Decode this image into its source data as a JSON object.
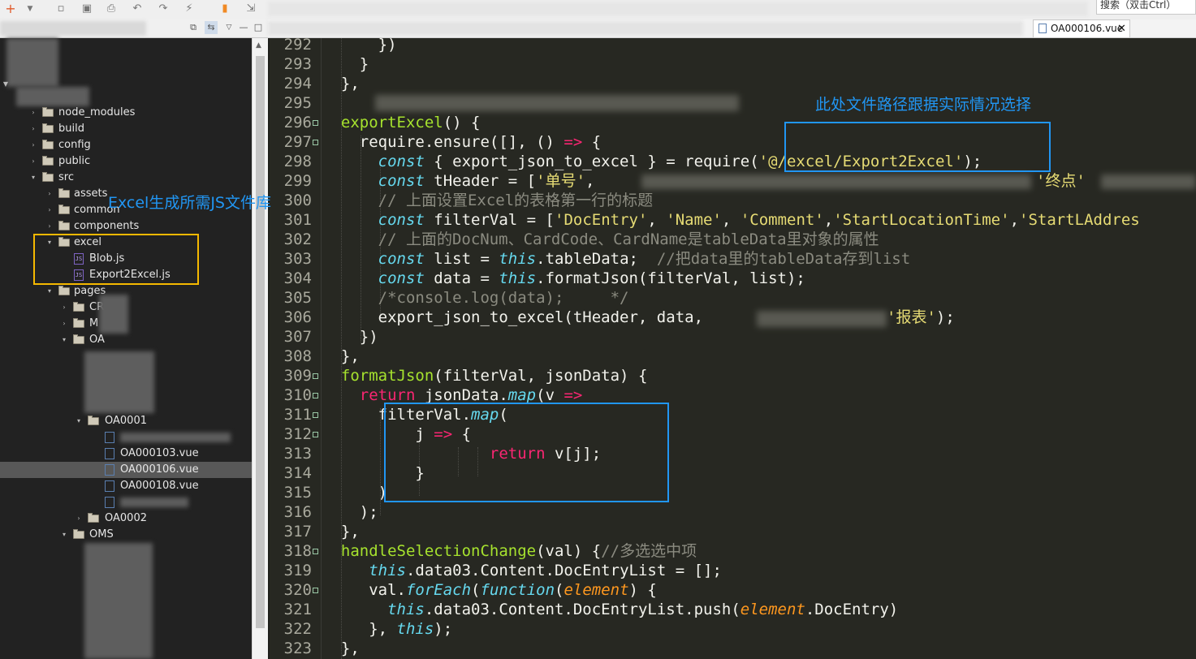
{
  "toolbar": {
    "search_placeholder": "搜索（双击Ctrl）"
  },
  "editor_tab": {
    "label": "OA000106.vue",
    "close": "✕"
  },
  "explorer": {
    "items": [
      {
        "label": "node_modules"
      },
      {
        "label": "build"
      },
      {
        "label": "config"
      },
      {
        "label": "public"
      },
      {
        "label": "src"
      },
      {
        "label": "assets"
      },
      {
        "label": "common"
      },
      {
        "label": "components"
      },
      {
        "label": "excel"
      },
      {
        "label": "Blob.js"
      },
      {
        "label": "Export2Excel.js"
      },
      {
        "label": "pages"
      },
      {
        "label": "CR"
      },
      {
        "label": "M"
      },
      {
        "label": "OA"
      },
      {
        "label": "OA0001"
      },
      {
        "label": "OA000103.vue"
      },
      {
        "label": "OA000106.vue"
      },
      {
        "label": "OA000108.vue"
      },
      {
        "label": "OA0002"
      },
      {
        "label": "OMS"
      }
    ]
  },
  "gutter": {
    "lines": [
      "292",
      "293",
      "294",
      "295",
      "296",
      "297",
      "298",
      "299",
      "300",
      "301",
      "302",
      "303",
      "304",
      "305",
      "306",
      "307",
      "308",
      "309",
      "310",
      "311",
      "312",
      "313",
      "314",
      "315",
      "316",
      "317",
      "318",
      "319",
      "320",
      "321",
      "322",
      "323"
    ]
  },
  "code": {
    "l292": "      })",
    "l293": "    }",
    "l294": "  },",
    "l296_name": "exportExcel",
    "l296_rest": "() {",
    "l297_a": "    require.ensure([], () ",
    "l297_op": "=>",
    "l297_b": " {",
    "l298_kw": "const",
    "l298_a": " { export_json_to_excel } = require(",
    "l298_str": "'@/excel/Export2Excel'",
    "l298_b": ");",
    "l299_kw": "const",
    "l299_a": " tHeader = [",
    "l299_s1": "'单号'",
    "l299_sep": ", ",
    "l299_s2": "'终点'",
    "l300": "// 上面设置Excel的表格第一行的标题",
    "l301_kw": "const",
    "l301_a": " filterVal = [",
    "l301_s1": "'DocEntry'",
    "l301_s2": "'Name'",
    "l301_s3": "'Comment'",
    "l301_s4": "'StartLocationTime'",
    "l301_s5": "'StartLAddres",
    "l302": "// 上面的DocNum、CardCode、CardName是tableData里对象的属性",
    "l303_kw": "const",
    "l303_a": " list = ",
    "l303_this": "this",
    "l303_b": ".tableData;  ",
    "l303_cmt": "//把data里的tableData存到list",
    "l304_kw": "const",
    "l304_a": " data = ",
    "l304_this": "this",
    "l304_b": ".formatJson(filterVal, list);",
    "l305": "/*console.log(data);     */",
    "l306_a": "export_json_to_excel(tHeader, data, ",
    "l306_str": "'报表'",
    "l306_b": ");",
    "l307": "    })",
    "l308": "  },",
    "l309_name": "formatJson",
    "l309_rest": "(filterVal, jsonData) {",
    "l310_ret": "return",
    "l310_a": " jsonData.",
    "l310_map": "map",
    "l310_b": "(v ",
    "l310_op": "=>",
    "l311_a": "filterVal.",
    "l311_map": "map",
    "l311_b": "(",
    "l312_a": "j ",
    "l312_op": "=>",
    "l312_b": " {",
    "l313_ret": "return",
    "l313_a": " v[j];",
    "l314": "}",
    "l315": ")",
    "l316": "    );",
    "l317": "  },",
    "l318_name": "handleSelectionChange",
    "l318_rest": "(val) {",
    "l318_cmt": "//多选选中项",
    "l319_this": "this",
    "l319_a": ".data03.Content.DocEntryList = [];",
    "l320_a": "val.",
    "l320_fe": "forEach",
    "l320_b": "(",
    "l320_fn": "function",
    "l320_c": "(",
    "l320_el": "element",
    "l320_d": ") {",
    "l321_this": "this",
    "l321_a": ".data03.Content.DocEntryList.push(",
    "l321_el": "element",
    "l321_b": ".DocEntry)",
    "l322_a": "}, ",
    "l322_this": "this",
    "l322_b": ");",
    "l323": "  },"
  },
  "annotations": {
    "js_library": "Excel生成所需JS文件库",
    "path_note": "此处文件路径跟据实际情况选择",
    "yellow_color": "#f5b800",
    "blue_color": "#2196f3"
  }
}
